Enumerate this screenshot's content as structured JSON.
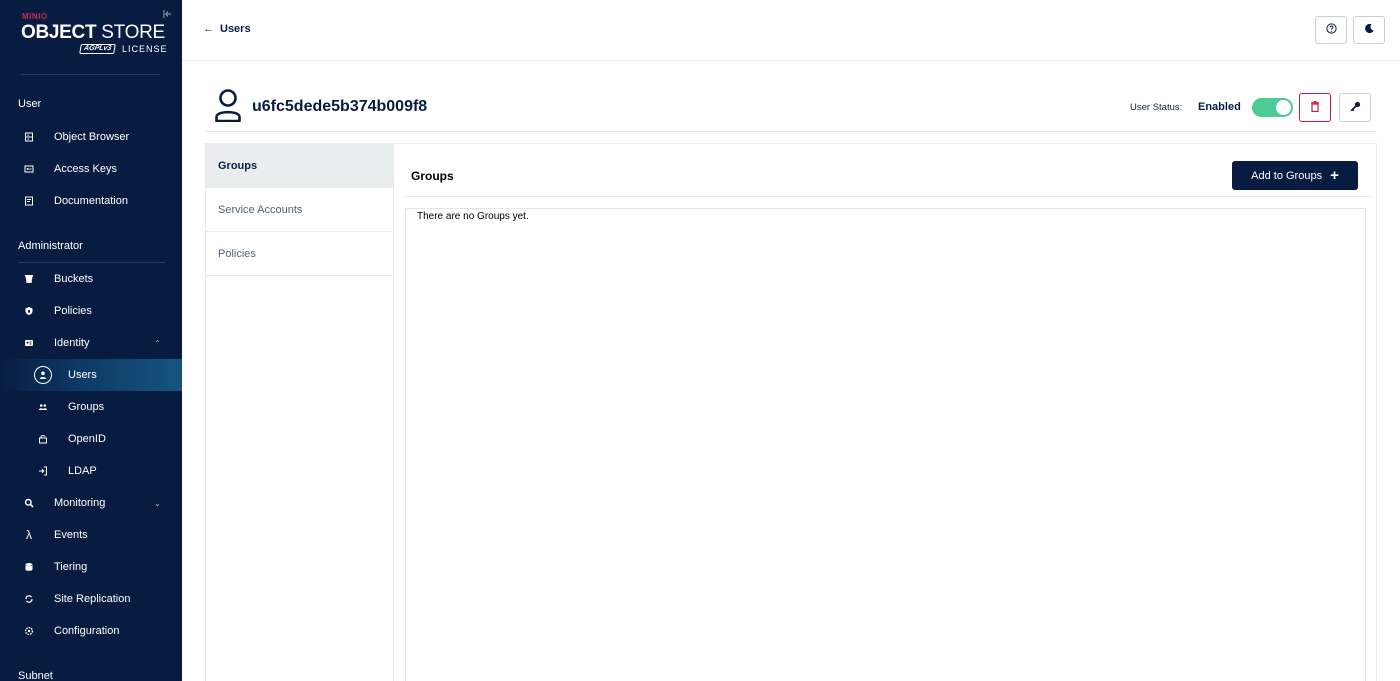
{
  "logo": {
    "minio": "MINIO",
    "brand_bold": "OBJECT",
    "brand_light": "STORE",
    "agpl": "AGPLv3",
    "license": "LICENSE"
  },
  "sidebar": {
    "section_user": "User",
    "section_admin": "Administrator",
    "section_subnet": "Subnet",
    "user_items": [
      {
        "label": "Object Browser",
        "icon": "object-browser-icon"
      },
      {
        "label": "Access Keys",
        "icon": "access-keys-icon"
      },
      {
        "label": "Documentation",
        "icon": "documentation-icon"
      }
    ],
    "admin_items": [
      {
        "label": "Buckets",
        "icon": "bucket-icon"
      },
      {
        "label": "Policies",
        "icon": "policy-icon"
      },
      {
        "label": "Identity",
        "icon": "identity-icon"
      }
    ],
    "identity_items": [
      {
        "label": "Users",
        "icon": "user-icon",
        "active": true
      },
      {
        "label": "Groups",
        "icon": "groups-icon"
      },
      {
        "label": "OpenID",
        "icon": "openid-icon"
      },
      {
        "label": "LDAP",
        "icon": "ldap-icon"
      }
    ],
    "more_items": [
      {
        "label": "Monitoring",
        "icon": "monitoring-icon"
      },
      {
        "label": "Events",
        "icon": "lambda-icon"
      },
      {
        "label": "Tiering",
        "icon": "tiering-icon"
      },
      {
        "label": "Site Replication",
        "icon": "replication-icon"
      },
      {
        "label": "Configuration",
        "icon": "gear-icon"
      }
    ]
  },
  "topbar": {
    "back_label": "Users",
    "back_arrow": "←"
  },
  "user": {
    "name": "u6fc5dede5b374b009f8",
    "status_label": "User Status:",
    "status_value": "Enabled",
    "enabled": true
  },
  "tabs": [
    {
      "label": "Groups",
      "active": true
    },
    {
      "label": "Service Accounts"
    },
    {
      "label": "Policies"
    }
  ],
  "panel": {
    "title": "Groups",
    "add_button": "Add to Groups",
    "add_plus": "+",
    "empty_message": "There are no Groups yet."
  },
  "colors": {
    "sidebar_bg": "#081c42",
    "accent": "#081c42",
    "toggle_on": "#4ccb92",
    "danger": "#c51b3f",
    "brand_red": "#c72e49"
  }
}
